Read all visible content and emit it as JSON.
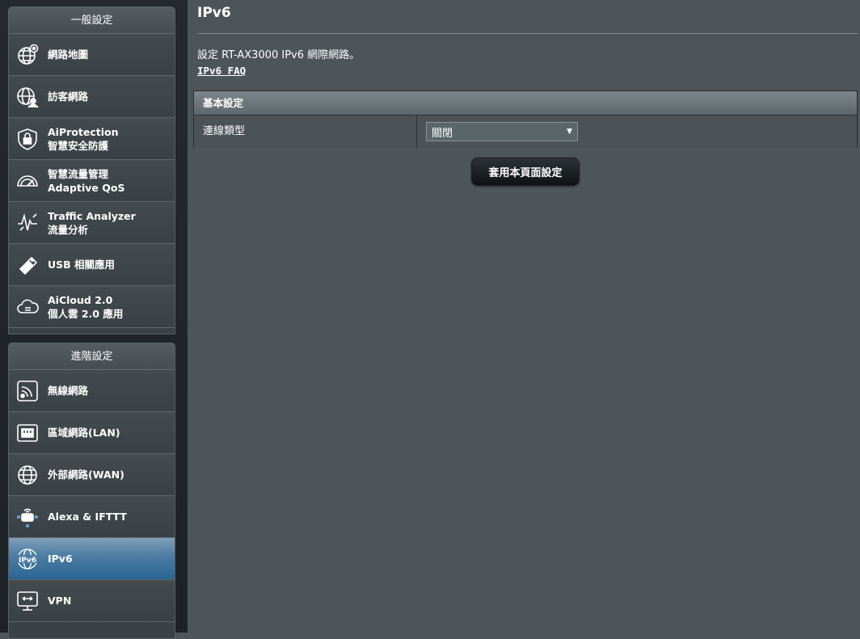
{
  "sidebar": {
    "general": {
      "header": "一般設定",
      "items": [
        {
          "line1": "網路地圖",
          "line2": ""
        },
        {
          "line1": "訪客網路",
          "line2": ""
        },
        {
          "line1": "AiProtection",
          "line2": "智慧安全防護"
        },
        {
          "line1": "智慧流量管理",
          "line2": "Adaptive QoS"
        },
        {
          "line1": "Traffic Analyzer",
          "line2": "流量分析"
        },
        {
          "line1": "USB 相關應用",
          "line2": ""
        },
        {
          "line1": "AiCloud 2.0",
          "line2": "個人雲 2.0 應用"
        }
      ]
    },
    "advanced": {
      "header": "進階設定",
      "items": [
        {
          "line1": "無線網路",
          "line2": ""
        },
        {
          "line1": "區域網路(LAN)",
          "line2": ""
        },
        {
          "line1": "外部網路(WAN)",
          "line2": ""
        },
        {
          "line1": "Alexa & IFTTT",
          "line2": ""
        },
        {
          "line1": "IPv6",
          "line2": ""
        },
        {
          "line1": "VPN",
          "line2": ""
        }
      ]
    }
  },
  "main": {
    "title": "IPv6",
    "description": "設定 RT-AX3000 IPv6 網際網路。",
    "faq_link": "IPv6 FAQ",
    "section_header": "基本設定",
    "connection_type_label": "連線類型",
    "connection_type_value": "關閉",
    "apply_button": "套用本頁面設定"
  },
  "colors": {
    "background": "#4d5559",
    "active_item": "#2a6494",
    "icon_stroke": "#ffffff"
  }
}
